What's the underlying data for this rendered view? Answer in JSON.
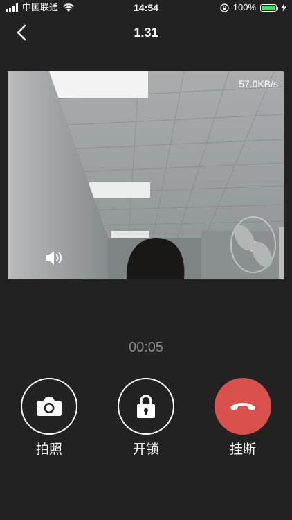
{
  "status_bar": {
    "carrier": "中国联通",
    "time": "14:54",
    "battery": "100%",
    "battery_level": 1.0,
    "icons": [
      "signal-icon",
      "wifi-icon",
      "rotation-lock-icon",
      "battery-icon",
      "charging-icon"
    ]
  },
  "nav": {
    "title": "1.31",
    "back_icon": "chevron-left-icon"
  },
  "video": {
    "speed": "57.0KB/s",
    "speaker_icon": "speaker-icon"
  },
  "call": {
    "timer": "00:05"
  },
  "controls": [
    {
      "label": "拍照",
      "icon": "camera-icon"
    },
    {
      "label": "开锁",
      "icon": "padlock-icon"
    },
    {
      "label": "挂断",
      "icon": "hang-up-icon",
      "color": "#d9504d"
    }
  ],
  "colors": {
    "background": "#222222",
    "hangup": "#d9504d",
    "battery_fill": "#4cd964",
    "timer_text": "#8a8a8a"
  }
}
